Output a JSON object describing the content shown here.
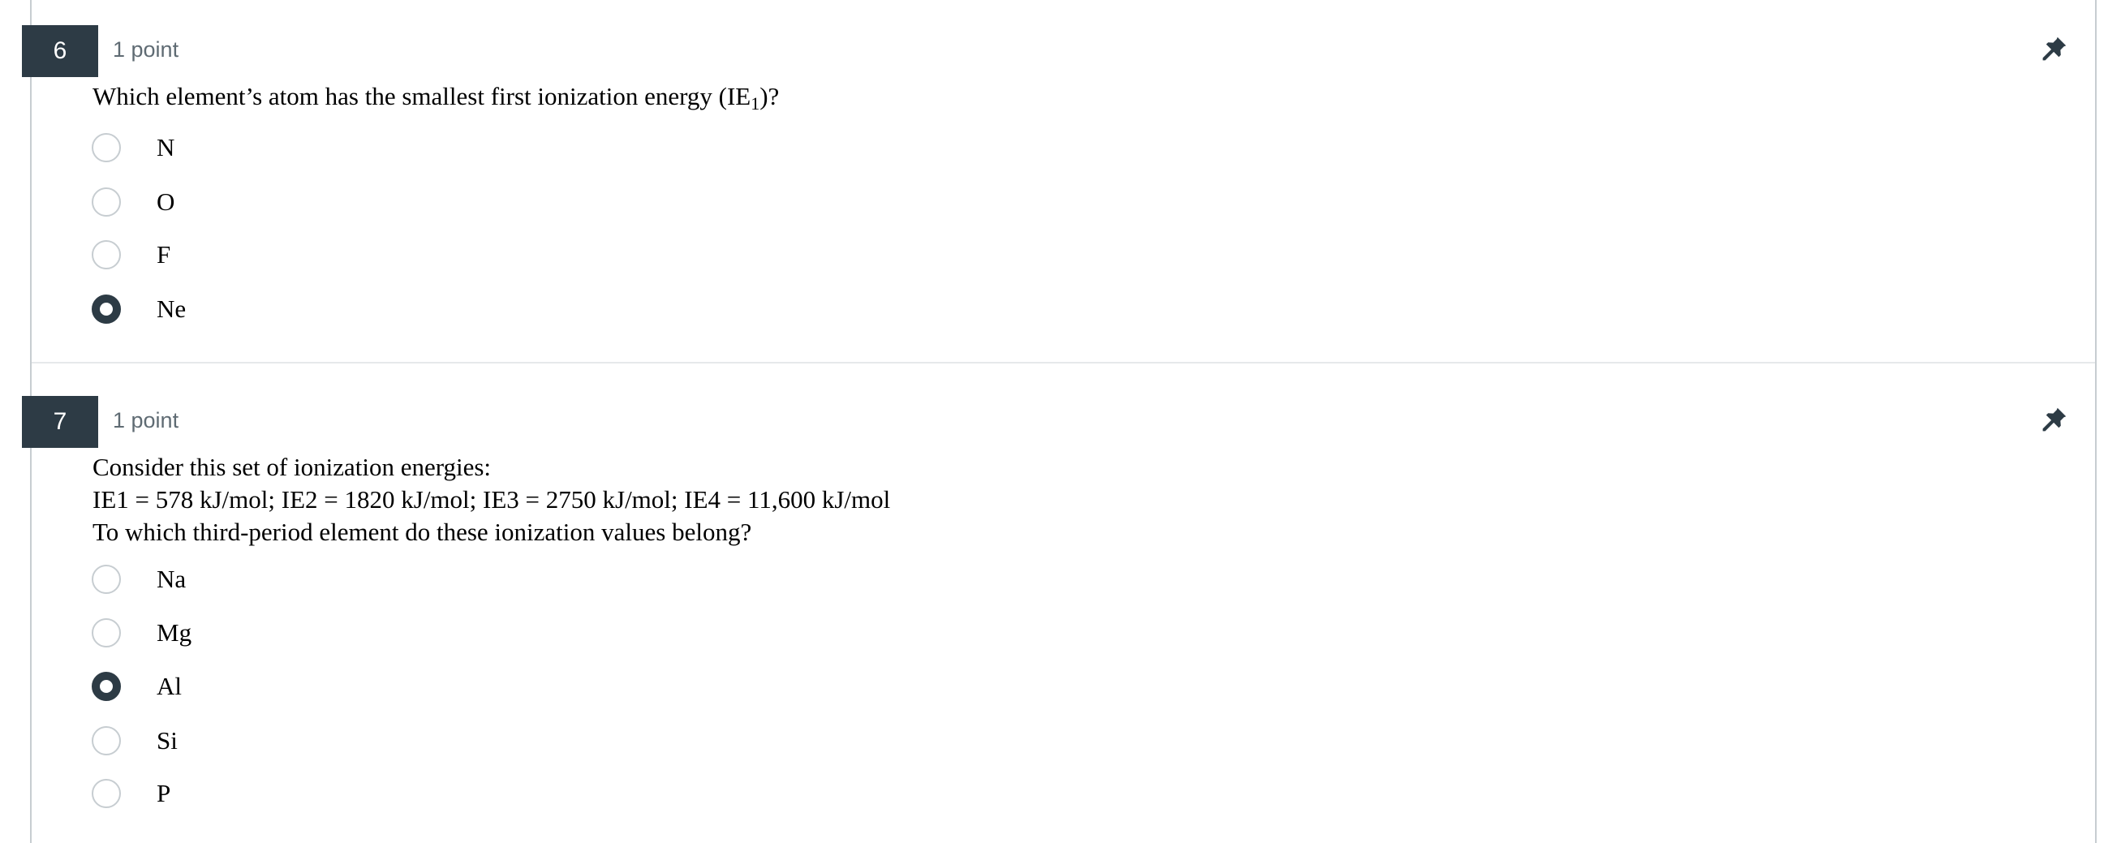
{
  "questions": [
    {
      "number": "6",
      "points": "1 point",
      "text_before": "Which element’s atom has the smallest first ionization energy (IE",
      "text_sub": "1",
      "text_after": ")?",
      "answers": [
        {
          "label": "N",
          "selected": false
        },
        {
          "label": "O",
          "selected": false
        },
        {
          "label": "F",
          "selected": false
        },
        {
          "label": "Ne",
          "selected": true
        }
      ]
    },
    {
      "number": "7",
      "points": "1 point",
      "lines": [
        "Consider this set of ionization energies:",
        "IE1 = 578 kJ/mol; IE2 = 1820 kJ/mol; IE3 = 2750 kJ/mol; IE4 = 11,600 kJ/mol",
        "To which third-period element do these ionization values belong?"
      ],
      "answers": [
        {
          "label": "Na",
          "selected": false
        },
        {
          "label": "Mg",
          "selected": false
        },
        {
          "label": "Al",
          "selected": true
        },
        {
          "label": "Si",
          "selected": false
        },
        {
          "label": "P",
          "selected": false
        }
      ]
    }
  ],
  "icons": {
    "pin": "pin-icon"
  },
  "colors": {
    "badge": "#2d3b45",
    "selected_radio": "#2d3b45",
    "radio_border": "#c7cdd1"
  }
}
